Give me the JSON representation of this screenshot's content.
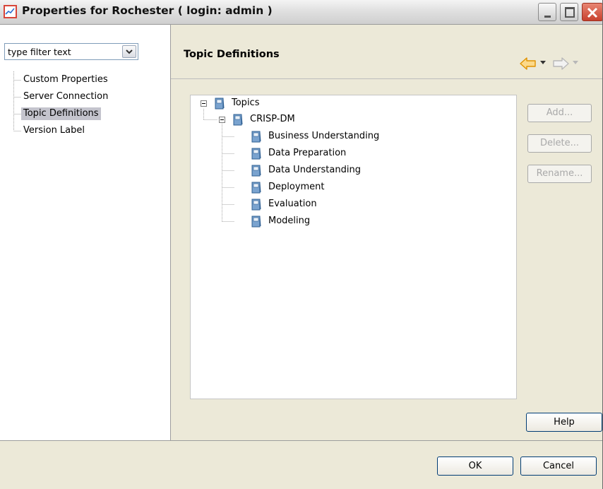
{
  "window": {
    "title": "Properties for Rochester ( login: admin )",
    "app_icon": "chart-icon",
    "controls": [
      "minimize-icon",
      "maximize-icon",
      "close-icon"
    ]
  },
  "sidebar": {
    "filter": {
      "value": "type filter text",
      "dropdown_icon": "chevron-down-icon"
    },
    "items": [
      {
        "label": "Custom Properties",
        "selected": false
      },
      {
        "label": "Server Connection",
        "selected": false
      },
      {
        "label": "Topic Definitions",
        "selected": true
      },
      {
        "label": "Version Label",
        "selected": false
      }
    ]
  },
  "main": {
    "title": "Topic Definitions",
    "nav": {
      "back_icon": "arrow-left-icon",
      "forward_icon": "arrow-right-icon"
    },
    "tree": {
      "root": "Topics",
      "group": "CRISP-DM",
      "children": [
        "Business Understanding",
        "Data Preparation",
        "Data Understanding",
        "Deployment",
        "Evaluation",
        "Modeling"
      ]
    },
    "buttons": {
      "add": "Add...",
      "delete": "Delete...",
      "rename": "Rename..."
    },
    "help": "Help"
  },
  "footer": {
    "ok": "OK",
    "cancel": "Cancel"
  },
  "colors": {
    "selection": "#c4c4cd",
    "accent_arrow": "#f0a800",
    "book": "#7aa3cf"
  }
}
